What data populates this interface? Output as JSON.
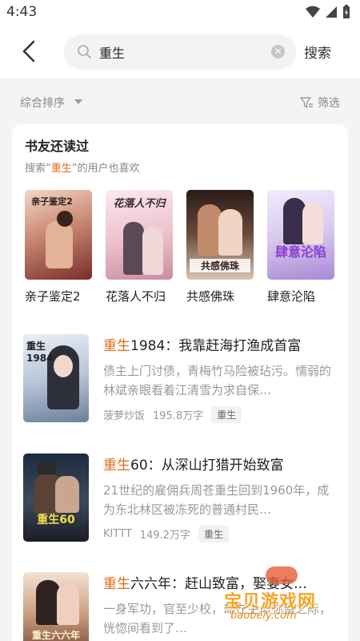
{
  "status_bar": {
    "time": "4:43"
  },
  "header": {
    "search_value": "重生",
    "search_button": "搜索"
  },
  "sort_row": {
    "sort_label": "综合排序",
    "filter_label": "筛选"
  },
  "recommend": {
    "title": "书友还读过",
    "subtitle_prefix": "搜索“",
    "subtitle_keyword": "重生",
    "subtitle_suffix": "”的用户也喜欢",
    "items": [
      {
        "name": "亲子鉴定2",
        "cover_text": "亲子鉴定2"
      },
      {
        "name": "花落人不归",
        "cover_text": "花落人不归"
      },
      {
        "name": "共感佛珠",
        "cover_text": "共感佛珠"
      },
      {
        "name": "肆意沦陷",
        "cover_text": "肆意沦陷"
      }
    ]
  },
  "books": [
    {
      "title_hl": "重生",
      "title_rest": "1984：我靠赶海打渔成首富",
      "desc": "债主上门讨债，青梅竹马险被玷污。懦弱的林斌亲眼看着江清雪为求自保…",
      "author": "菠萝炒饭",
      "words": "195.8万字",
      "tag": "重生",
      "cover_text": "重生1984"
    },
    {
      "title_hl": "重生",
      "title_rest": "60：从深山打猎开始致富",
      "desc": "21世纪的雇佣兵周苍重生回到1960年，成为东北林区被冻死的普通村民…",
      "author": "KITTT",
      "words": "149.2万字",
      "tag": "重生",
      "cover_text": "重生60"
    },
    {
      "title_hl": "重生",
      "title_rest": "六六年：赶山致富，娶妻女…",
      "desc": "一身军功，官至少校，却在生命弥留之际，恍惚间看到了…",
      "author": "",
      "words": "",
      "tag": "",
      "cover_text": "重生六六年"
    }
  ],
  "watermark": {
    "text": "宝贝游戏网",
    "url": "baobeiy.com"
  },
  "colors": {
    "accent": "#e26a19",
    "text": "#222222",
    "muted": "#999999",
    "background": "#f4f4f6"
  }
}
